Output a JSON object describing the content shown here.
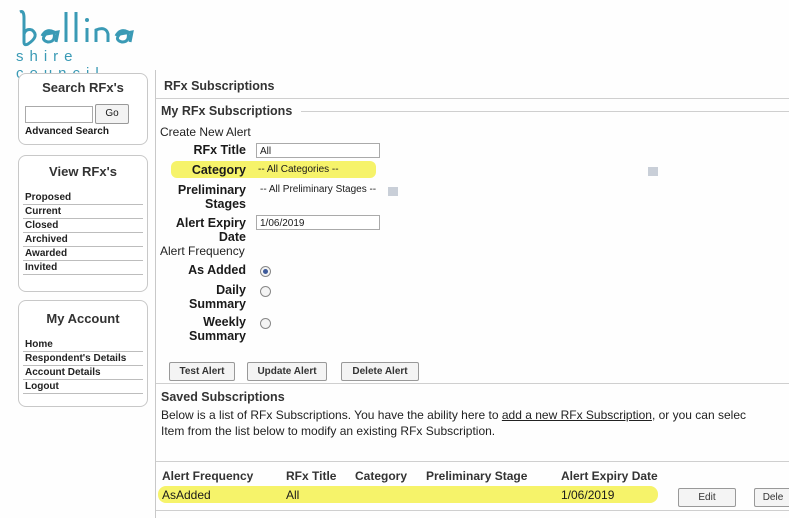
{
  "brand": {
    "name": "balli",
    "tagline": "shire council"
  },
  "search": {
    "title": "Search RFx's",
    "go_label": "Go",
    "advanced_label": "Advanced Search"
  },
  "view": {
    "title": "View RFx's",
    "items": [
      "Proposed",
      "Current",
      "Closed",
      "Archived",
      "Awarded",
      "Invited"
    ]
  },
  "account": {
    "title": "My Account",
    "items": [
      "Home",
      "Respondent's Details",
      "Account Details",
      "Logout"
    ]
  },
  "page": {
    "title": "RFx Subscriptions",
    "section_title": "My RFx Subscriptions",
    "create_label": "Create New Alert",
    "fields": {
      "rfx_title_label": "RFx Title",
      "rfx_title_value": "All",
      "category_label": "Category",
      "category_value": "-- All Categories --",
      "prelim_label_1": "Preliminary",
      "prelim_label_2": "Stages",
      "prelim_value": "-- All Preliminary Stages --",
      "expiry_label_1": "Alert Expiry",
      "expiry_label_2": "Date",
      "expiry_value": "1/06/2019"
    },
    "frequency": {
      "title": "Alert Frequency",
      "as_added": "As Added",
      "daily_1": "Daily",
      "daily_2": "Summary",
      "weekly_1": "Weekly",
      "weekly_2": "Summary",
      "selected": "As Added"
    },
    "buttons": {
      "test": "Test Alert",
      "update": "Update Alert",
      "delete": "Delete Alert"
    },
    "saved": {
      "title": "Saved Subscriptions",
      "desc_1a": "Below is a list of RFx Subscriptions. You have the ability here to ",
      "desc_link": "add a new RFx Subscription",
      "desc_1b": ", or you can selec",
      "desc_2": "Item from the list below to modify an existing RFx Subscription.",
      "headers": [
        "Alert Frequency",
        "RFx Title",
        "Category",
        "Preliminary Stage",
        "Alert Expiry Date"
      ],
      "row": {
        "frequency": "AsAdded",
        "title": "All",
        "category": "",
        "stage": "",
        "expiry": "1/06/2019"
      },
      "edit_label": "Edit",
      "delete_label": "Dele"
    }
  },
  "colors": {
    "highlight": "#f6f36a",
    "logo": "#3a9ab5"
  }
}
